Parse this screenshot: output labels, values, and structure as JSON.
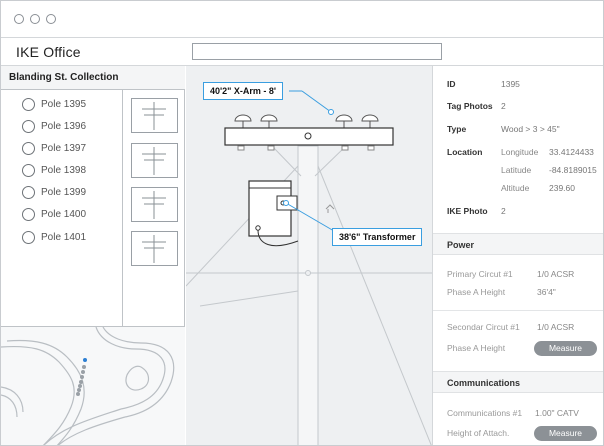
{
  "window": {
    "app_title": "IKE Office",
    "search_value": ""
  },
  "collection": {
    "title": "Blanding St. Collection",
    "poles": [
      {
        "label": "Pole 1395"
      },
      {
        "label": "Pole 1396"
      },
      {
        "label": "Pole 1397"
      },
      {
        "label": "Pole 1398"
      },
      {
        "label": "Pole 1399"
      },
      {
        "label": "Pole 1400"
      },
      {
        "label": "Pole 1401"
      }
    ]
  },
  "drawing": {
    "xarm_callout": "40'2\" X-Arm - 8'",
    "transformer_callout": "38'6\" Transformer"
  },
  "details": {
    "id_label": "ID",
    "id_value": "1395",
    "tag_photos_label": "Tag Photos",
    "tag_photos_value": "2",
    "type_label": "Type",
    "type_value": "Wood > 3 > 45\"",
    "location_label": "Location",
    "longitude_label": "Longitude",
    "longitude_value": "33.4124433",
    "latitude_label": "Latitude",
    "latitude_value": "-84.8189015",
    "altitude_label": "Altitude",
    "altitude_value": "239.60",
    "ike_photo_label": "IKE Photo",
    "ike_photo_value": "2"
  },
  "power": {
    "title": "Power",
    "primary_label": "Primary Circut #1",
    "primary_value": "1/0 ACSR",
    "phase_a_label": "Phase A Height",
    "phase_a_value": "36'4\"",
    "secondary_label": "Secondar Circut #1",
    "secondary_value": "1/0 ACSR",
    "phase_a2_label": "Phase A Height",
    "measure_label": "Measure"
  },
  "communications": {
    "title": "Communications",
    "comm_label": "Communications #1",
    "comm_value": "1.00\" CATV",
    "height_label": "Height of Attach.",
    "measure_label": "Measure"
  },
  "colors": {
    "accent": "#3a9ee0",
    "button": "#8c9196",
    "map_dot": "#2d7fd3"
  }
}
